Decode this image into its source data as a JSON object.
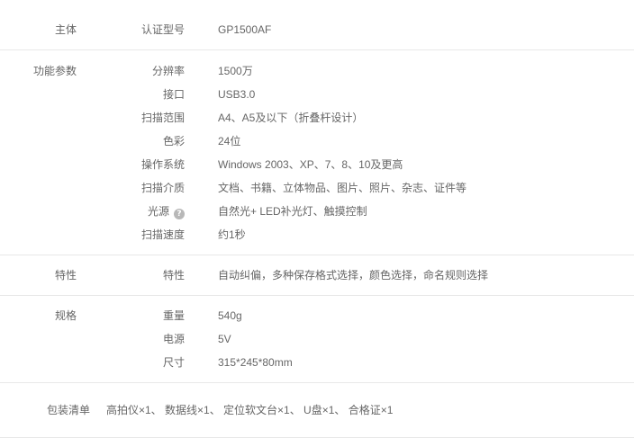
{
  "sections": {
    "main": {
      "group": "主体",
      "rows": [
        {
          "key": "认证型号",
          "value": "GP1500AF"
        }
      ]
    },
    "func": {
      "group": "功能参数",
      "rows": [
        {
          "key": "分辨率",
          "value": "1500万"
        },
        {
          "key": "接口",
          "value": "USB3.0"
        },
        {
          "key": "扫描范围",
          "value": "A4、A5及以下（折叠杆设计）"
        },
        {
          "key": "色彩",
          "value": "24位"
        },
        {
          "key": "操作系统",
          "value": "Windows 2003、XP、7、8、10及更高"
        },
        {
          "key": "扫描介质",
          "value": "文档、书籍、立体物品、图片、照片、杂志、证件等"
        },
        {
          "key": "光源",
          "value": "自然光+ LED补光灯、触摸控制",
          "help_icon": "question-circle-icon"
        },
        {
          "key": "扫描速度",
          "value": "约1秒"
        }
      ]
    },
    "feature": {
      "group": "特性",
      "rows": [
        {
          "key": "特性",
          "value": "自动纠偏，多种保存格式选择，颜色选择，命名规则选择"
        }
      ]
    },
    "spec": {
      "group": "规格",
      "rows": [
        {
          "key": "重量",
          "value": "540g"
        },
        {
          "key": "电源",
          "value": "5V"
        },
        {
          "key": "尺寸",
          "value": "315*245*80mm"
        }
      ]
    },
    "package": {
      "group": "包装清单",
      "value": "高拍仪×1、 数据线×1、 定位软文台×1、 U盘×1、 合格证×1"
    }
  },
  "colors": {
    "text": "#666666",
    "divider": "#e8e8e8",
    "icon": "#b8b8b8"
  }
}
